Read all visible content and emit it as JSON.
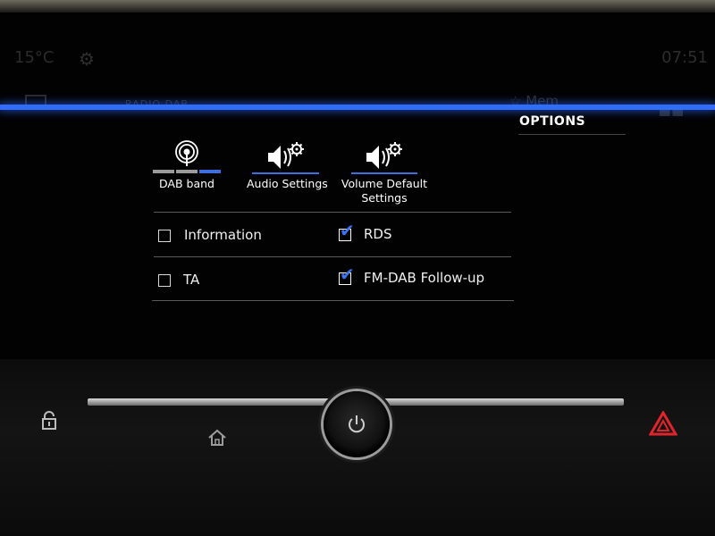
{
  "status": {
    "temperature": "15°C",
    "time": "07:51",
    "source": "RADIO DAB",
    "memory_label": "Mem"
  },
  "page_title": "OPTIONS",
  "tiles": [
    {
      "label": "DAB band",
      "icon": "radio-signal-icon"
    },
    {
      "label": "Audio Settings",
      "icon": "speaker-settings-icon"
    },
    {
      "label": "Volume Default\nSettings",
      "icon": "speaker-settings-icon"
    }
  ],
  "options": [
    {
      "label": "Information",
      "checked": false
    },
    {
      "label": "RDS",
      "checked": true
    },
    {
      "label": "TA",
      "checked": false
    },
    {
      "label": "FM-DAB Follow-up",
      "checked": true
    }
  ],
  "colors": {
    "accent": "#2f6cff",
    "checkmark": "#3a74f0",
    "hazard": "#e0242c",
    "background": "#020202"
  }
}
